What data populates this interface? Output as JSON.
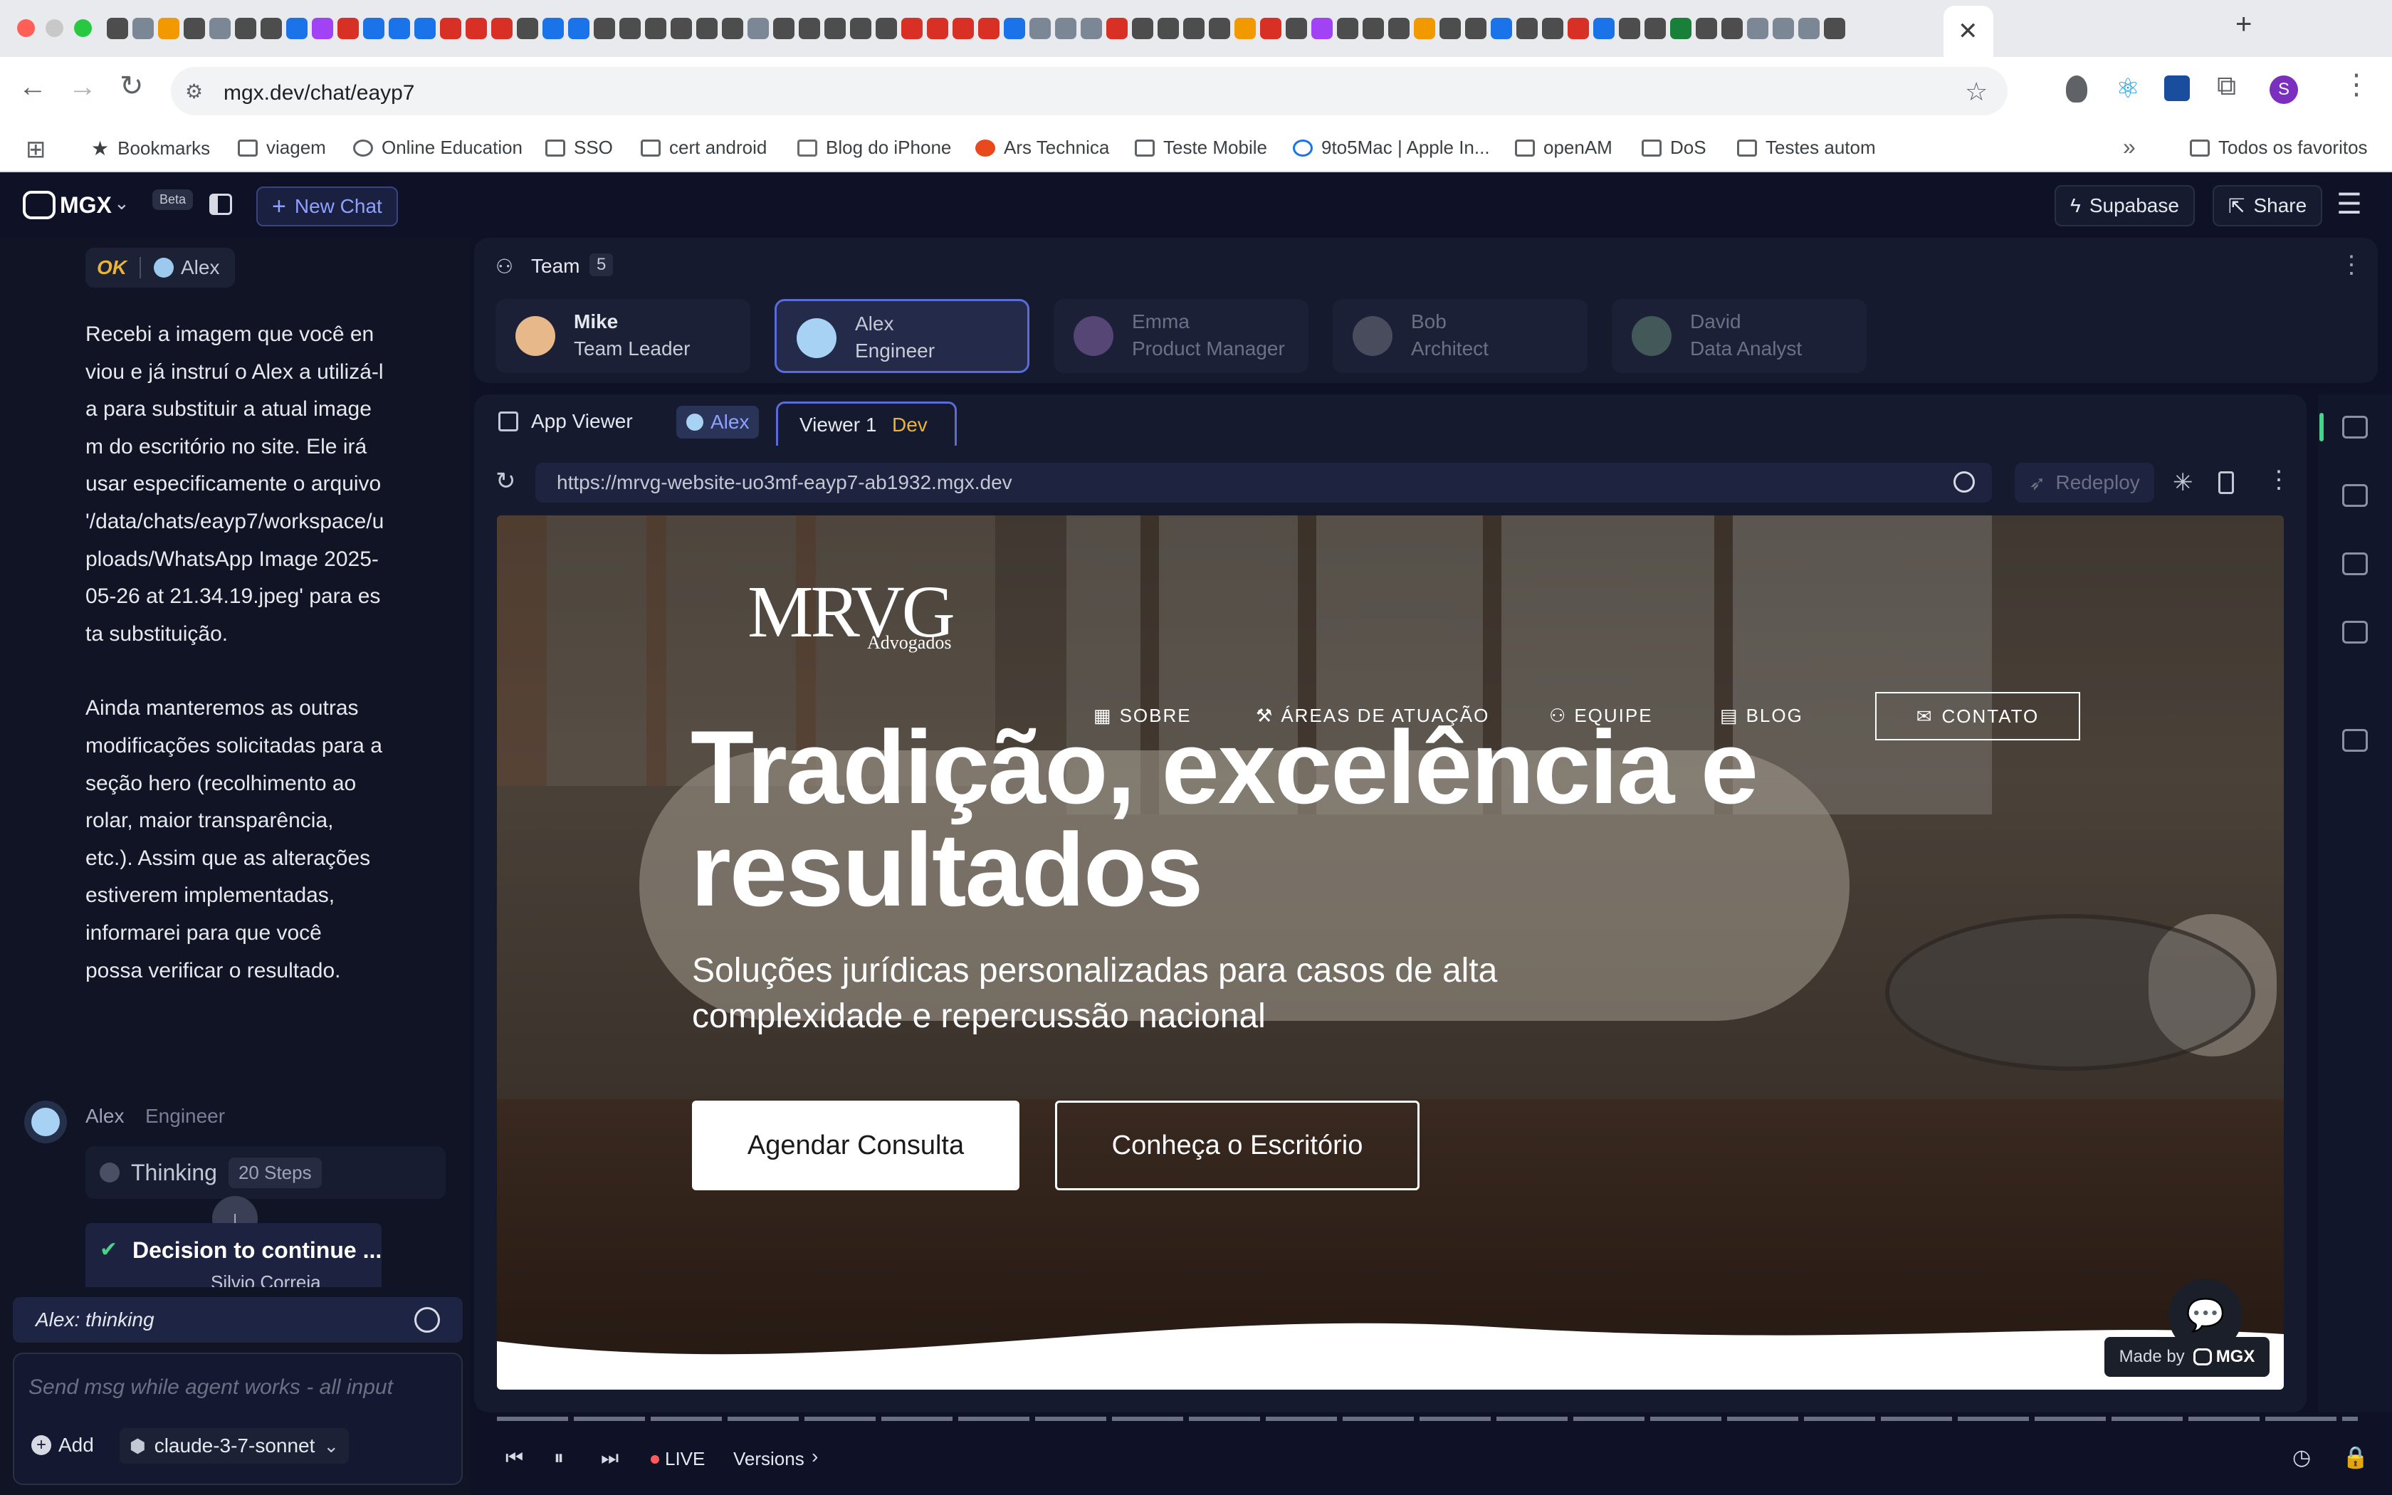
{
  "browser": {
    "url": "mgx.dev/chat/eayp7",
    "profile_initial": "S",
    "bookmarks": [
      "Bookmarks",
      "viagem",
      "Online Education",
      "SSO",
      "cert android",
      "Blog do iPhone",
      "Ars Technica",
      "Teste Mobile",
      "9to5Mac | Apple In...",
      "openAM",
      "DoS",
      "Testes autom"
    ],
    "all_bookmarks": "Todos os favoritos"
  },
  "app": {
    "logo": "MGX",
    "beta": "Beta",
    "new_chat": "New Chat",
    "supabase": "Supabase",
    "share": "Share"
  },
  "chat": {
    "status_ok": "OK",
    "status_agent": "Alex",
    "message_p1": "Recebi a imagem que você enviou e já instruí o Alex a utilizá-la para substituir a atual imagem do escritório no site. Ele irá usar especificamente o arquivo '/data/chats/eayp7/workspace/uploads/WhatsApp Image 2025-05-26 at 21.34.19.jpeg' para esta substituição.",
    "message_p2": "Ainda manteremos as outras modificações solicitadas para a seção hero (recolhimento ao rolar, maior transparência, etc.). Assim que as alterações estiverem implementadas, informarei para que você possa verificar o resultado.",
    "author_name": "Alex",
    "author_role": "Engineer",
    "thinking": "Thinking",
    "steps": "20 Steps",
    "decision": "Decision to continue ...",
    "decision_sub": "Silvio Correia",
    "agent_status": "Alex: thinking",
    "input_placeholder": "Send msg while agent works - all input",
    "add": "Add",
    "model": "claude-3-7-sonnet"
  },
  "team": {
    "title": "Team",
    "count": "5",
    "members": [
      {
        "name": "Mike",
        "role": "Team Leader"
      },
      {
        "name": "Alex",
        "role": "Engineer"
      },
      {
        "name": "Emma",
        "role": "Product Manager"
      },
      {
        "name": "Bob",
        "role": "Architect"
      },
      {
        "name": "David",
        "role": "Data Analyst"
      }
    ]
  },
  "viewer": {
    "app_viewer": "App Viewer",
    "alex_tab": "Alex",
    "viewer_tab": "Viewer 1",
    "dev_badge": "Dev",
    "url": "https://mrvg-website-uo3mf-eayp7-ab1932.mgx.dev",
    "redeploy": "Redeploy",
    "live": "LIVE",
    "versions": "Versions"
  },
  "site": {
    "logo": "MRVG",
    "logo_sub": "Advogados",
    "nav": [
      "SOBRE",
      "ÁREAS DE ATUAÇÃO",
      "EQUIPE",
      "BLOG"
    ],
    "contact": "CONTATO",
    "headline_1": "Tradição, excelência e",
    "headline_2": "resultados",
    "subtitle_1": "Soluções jurídicas personalizadas para casos de alta",
    "subtitle_2": "complexidade e repercussão nacional",
    "cta_primary": "Agendar Consulta",
    "cta_secondary": "Conheça o Escritório",
    "made_by": "Made by",
    "made_by_brand": "MGX"
  }
}
